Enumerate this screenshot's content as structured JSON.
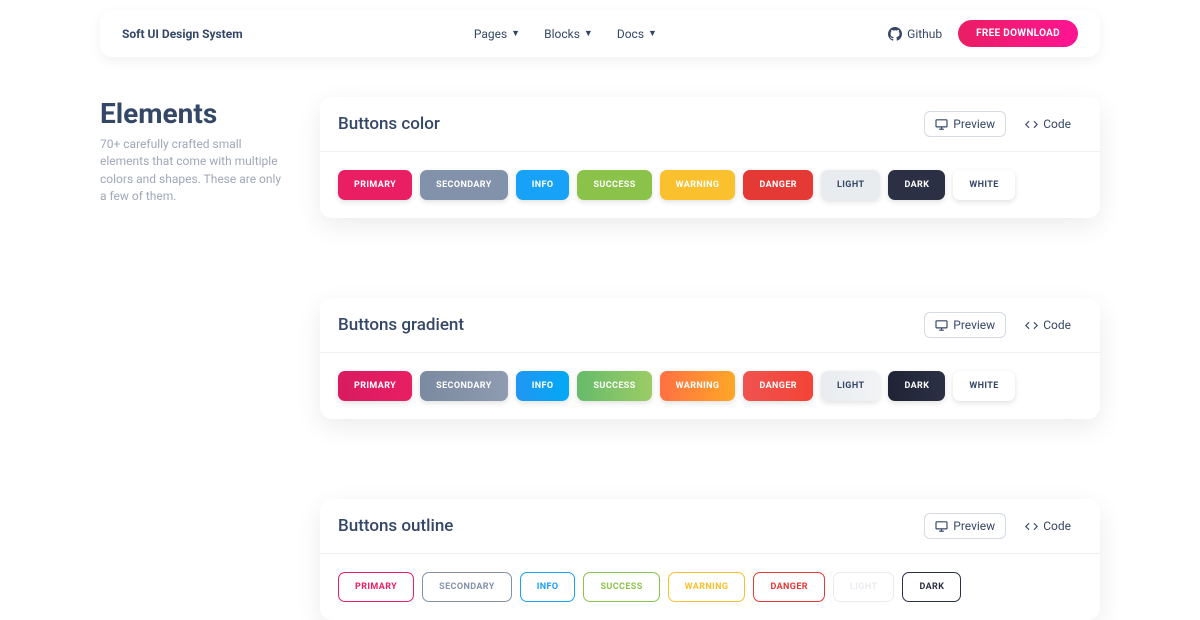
{
  "brand": "Soft UI Design System",
  "nav": {
    "pages": "Pages",
    "blocks": "Blocks",
    "docs": "Docs",
    "github": "Github",
    "free_download": "FREE DOWNLOAD"
  },
  "sidebar": {
    "title": "Elements",
    "description": "70+ carefully crafted small elements that come with multiple colors and shapes. These are only a few of them."
  },
  "toggle": {
    "preview": "Preview",
    "code": "Code"
  },
  "colors": {
    "primary": "#e91e63",
    "secondary": "#8392ab",
    "info": "#17a2f8",
    "success": "#8bc34a",
    "warning": "#fbc02d",
    "danger": "#e53935",
    "light": "#e9ecef",
    "dark": "#2c3044",
    "white": "#ffffff"
  },
  "gradients": {
    "primary": "linear-gradient(90deg,#d81b60,#e91e63)",
    "secondary": "linear-gradient(90deg,#7b8aa0,#8e9bb0)",
    "info": "linear-gradient(90deg,#2196f3,#03a9f4)",
    "success": "linear-gradient(90deg,#66bb6a,#9ccc65)",
    "warning": "linear-gradient(90deg,#ff7043,#ffa726)",
    "danger": "linear-gradient(90deg,#ef5350,#f44336)",
    "light": "linear-gradient(90deg,#e9ecef,#f1f3f5)",
    "dark": "linear-gradient(90deg,#1f2335,#2c3044)",
    "white": "linear-gradient(90deg,#ffffff,#ffffff)"
  },
  "sections": [
    {
      "title": "Buttons color"
    },
    {
      "title": "Buttons gradient"
    },
    {
      "title": "Buttons outline"
    }
  ],
  "labels": {
    "primary": "PRIMARY",
    "secondary": "SECONDARY",
    "info": "INFO",
    "success": "SUCCESS",
    "warning": "WARNING",
    "danger": "DANGER",
    "light": "LIGHT",
    "dark": "DARK",
    "white": "WHITE"
  }
}
